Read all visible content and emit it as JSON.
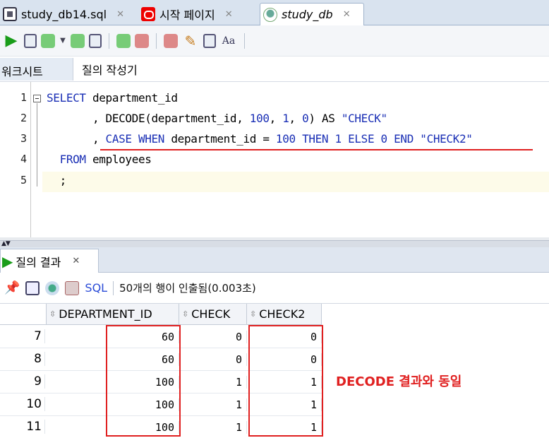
{
  "tabs": [
    {
      "label": "study_db14.sql",
      "icon": "sql-file-icon"
    },
    {
      "label": "시작 페이지",
      "icon": "oracle-icon"
    },
    {
      "label": "study_db",
      "icon": "db-connection-icon"
    }
  ],
  "subtabs": {
    "worksheet": "워크시트",
    "query_builder": "질의 작성기"
  },
  "editor": {
    "line_numbers": [
      "1",
      "2",
      "3",
      "4",
      "5"
    ]
  },
  "results": {
    "tab_label": "질의 결과",
    "sql_link": "SQL",
    "status": "50개의 행이 인출됨(0.003초)",
    "columns": [
      "DEPARTMENT_ID",
      "CHECK",
      "CHECK2"
    ],
    "rows": [
      {
        "num": "7",
        "dept": "60",
        "check": "0",
        "check2": "0"
      },
      {
        "num": "8",
        "dept": "60",
        "check": "0",
        "check2": "0"
      },
      {
        "num": "9",
        "dept": "100",
        "check": "1",
        "check2": "1"
      },
      {
        "num": "10",
        "dept": "100",
        "check": "1",
        "check2": "1"
      },
      {
        "num": "11",
        "dept": "100",
        "check": "1",
        "check2": "1"
      }
    ]
  },
  "annotation": "DECODE 결과와 동일",
  "colors": {
    "annotation_red": "#e02020",
    "keyword_blue": "#1a2fb5",
    "run_green": "#1a9d1a"
  }
}
